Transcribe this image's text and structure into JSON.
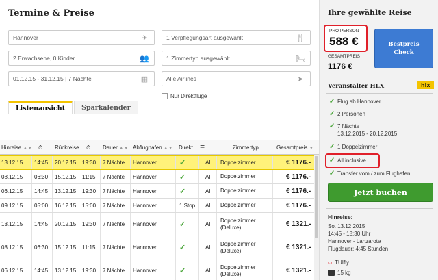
{
  "main": {
    "title": "Termine & Preise",
    "fields": {
      "departure": "Hannover",
      "meal": "1 Verpflegungsart ausgewählt",
      "travelers": "2 Erwachsene, 0 Kinder",
      "room": "1 Zimmertyp ausgewählt",
      "dates": "01.12.15 - 31.12.15 | 7 Nächte",
      "airlines": "Alle Airlines"
    },
    "direct_only_label": "Nur Direktflüge",
    "tabs": [
      "Listenansicht",
      "Sparkalender"
    ]
  },
  "table": {
    "headers": {
      "outbound": "Hinreise",
      "return": "Rückreise",
      "duration": "Dauer",
      "airport": "Abflughafen",
      "direct": "Direkt",
      "room": "Zimmertyp",
      "total": "Gesamtpreis"
    },
    "rows": [
      {
        "d1": "13.12.15",
        "t1": "14:45",
        "d2": "20.12.15",
        "t2": "19:30",
        "dur": "7 Nächte",
        "ap": "Hannover",
        "direct": "✓",
        "meal": "AI",
        "room": "Doppelzimmer",
        "price": "€ 1176.-"
      },
      {
        "d1": "08.12.15",
        "t1": "06:30",
        "d2": "15.12.15",
        "t2": "11:15",
        "dur": "7 Nächte",
        "ap": "Hannover",
        "direct": "✓",
        "meal": "AI",
        "room": "Doppelzimmer",
        "price": "€ 1176.-"
      },
      {
        "d1": "06.12.15",
        "t1": "14:45",
        "d2": "13.12.15",
        "t2": "19:30",
        "dur": "7 Nächte",
        "ap": "Hannover",
        "direct": "✓",
        "meal": "AI",
        "room": "Doppelzimmer",
        "price": "€ 1176.-"
      },
      {
        "d1": "09.12.15",
        "t1": "05:00",
        "d2": "16.12.15",
        "t2": "15:00",
        "dur": "7 Nächte",
        "ap": "Hannover",
        "direct": "1 Stop",
        "meal": "AI",
        "room": "Doppelzimmer",
        "price": "€ 1176.-"
      },
      {
        "d1": "13.12.15",
        "t1": "14:45",
        "d2": "20.12.15",
        "t2": "19:30",
        "dur": "7 Nächte",
        "ap": "Hannover",
        "direct": "✓",
        "meal": "AI",
        "room": "Doppelzimmer (Deluxe)",
        "price": "€ 1321.-"
      },
      {
        "d1": "08.12.15",
        "t1": "06:30",
        "d2": "15.12.15",
        "t2": "11:15",
        "dur": "7 Nächte",
        "ap": "Hannover",
        "direct": "✓",
        "meal": "AI",
        "room": "Doppelzimmer (Deluxe)",
        "price": "€ 1321.-"
      },
      {
        "d1": "06.12.15",
        "t1": "14:45",
        "d2": "13.12.15",
        "t2": "19:30",
        "dur": "7 Nächte",
        "ap": "Hannover",
        "direct": "✓",
        "meal": "AI",
        "room": "Doppelzimmer (Deluxe)",
        "price": "€ 1321.-"
      }
    ]
  },
  "sidebar": {
    "title": "Ihre gewählte Reise",
    "per_person_label": "PRO PERSON",
    "per_person_price": "588 €",
    "total_label": "GESAMTPREIS",
    "total_price": "1176 €",
    "check_button": "Bestpreis Check",
    "operator_label": "Veranstalter HLX",
    "operator_logo": "hlx",
    "features": [
      "Flug ab Hannover",
      "2 Personen",
      "7 Nächte",
      "13.12.2015 - 20.12.2015",
      "1 Doppelzimmer",
      "All inclusive",
      "Transfer vom / zum Flughafen"
    ],
    "book_button": "Jetzt buchen",
    "hinreise_title": "Hinreise:",
    "hinreise": [
      "So. 13.12.2015",
      "14:45 - 18:30 Uhr",
      "Hannover - Lanzarote",
      "Flugdauer: 4:45 Stunden"
    ],
    "airline": "TUIfly",
    "baggage": "15 kg"
  },
  "colors": {
    "accent_yellow": "#f4c400",
    "selected_row": "#fff27a",
    "check_green": "#4aa53a",
    "book_green": "#3f9b2f",
    "check_blue": "#3d7bd3",
    "highlight_red": "#e0202a"
  }
}
